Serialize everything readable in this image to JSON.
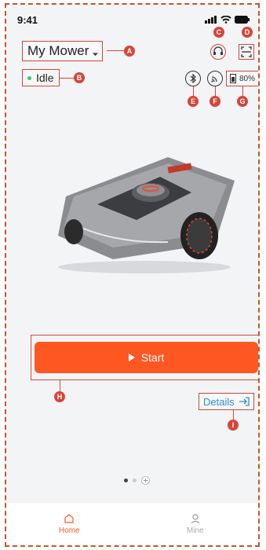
{
  "status_bar": {
    "time": "9:41"
  },
  "header": {
    "title": "My Mower",
    "status": "Idle",
    "battery": "80%"
  },
  "annotations": [
    "A",
    "B",
    "C",
    "D",
    "E",
    "F",
    "G",
    "H",
    "I"
  ],
  "actions": {
    "start_label": "Start",
    "details_label": "Details"
  },
  "tabs": [
    {
      "label": "Home",
      "active": true
    },
    {
      "label": "Mine",
      "active": false
    }
  ],
  "colors": {
    "accent": "#ff5722",
    "annotation": "#d6453a",
    "link": "#2b8fd6",
    "status_dot": "#2ecc71"
  },
  "icons": [
    "headset-icon",
    "scan-icon",
    "bluetooth-icon",
    "wifi-icon",
    "battery-icon",
    "play-icon",
    "details-arrow-icon",
    "home-icon",
    "user-icon"
  ]
}
